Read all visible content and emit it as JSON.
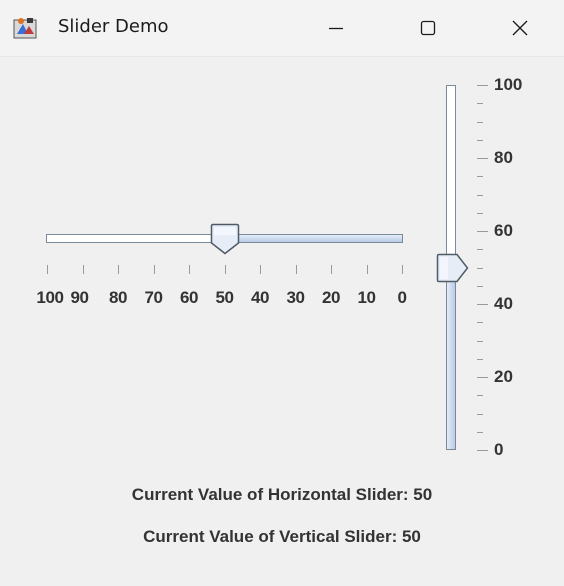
{
  "window": {
    "title": "Slider Demo",
    "icon": "java-app-icon",
    "controls": [
      "minimize-icon",
      "maximize-icon",
      "close-icon"
    ]
  },
  "horizontal_slider": {
    "min": 0,
    "max": 100,
    "value": 50,
    "inverted": true,
    "major_ticks": [
      100,
      90,
      80,
      70,
      60,
      50,
      40,
      30,
      20,
      10,
      0
    ],
    "labels": [
      "100",
      "90",
      "80",
      "70",
      "60",
      "50",
      "40",
      "30",
      "20",
      "10",
      "0"
    ]
  },
  "vertical_slider": {
    "min": 0,
    "max": 100,
    "value": 50,
    "major_ticks": [
      100,
      80,
      60,
      40,
      20,
      0
    ],
    "labels": [
      "100",
      "80",
      "60",
      "40",
      "20",
      "0"
    ]
  },
  "status": {
    "horizontal": "Current Value of Horizontal Slider: 50",
    "vertical": "Current Value of Vertical Slider: 50"
  },
  "colors": {
    "track_fill": "#b9cbe6",
    "thumb_fill": "#dfe8f5",
    "thumb_border": "#4f5b66",
    "background": "#f0f0f0"
  }
}
